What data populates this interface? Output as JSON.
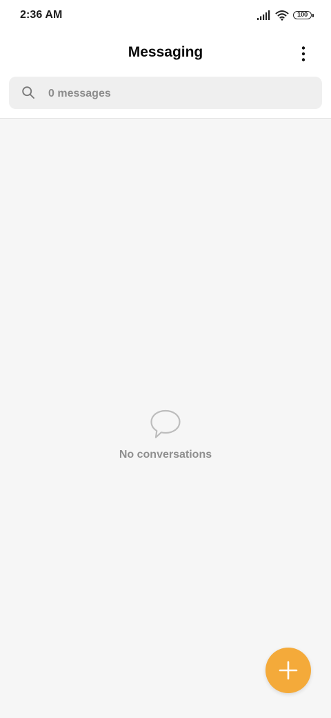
{
  "status_bar": {
    "time": "2:36 AM",
    "battery_level": "100",
    "icons": [
      "signal-icon",
      "wifi-icon",
      "battery-icon"
    ]
  },
  "header": {
    "title": "Messaging",
    "more_icon": "more-vertical-icon"
  },
  "search": {
    "placeholder": "0 messages",
    "value": "",
    "icon": "search-icon"
  },
  "empty_state": {
    "icon": "chat-bubble-icon",
    "text": "No conversations"
  },
  "fab": {
    "icon": "plus-icon",
    "color": "#f4aa3a"
  },
  "colors": {
    "accent": "#f4aa3a",
    "content_background": "#f6f6f6",
    "search_background": "#efefef"
  }
}
